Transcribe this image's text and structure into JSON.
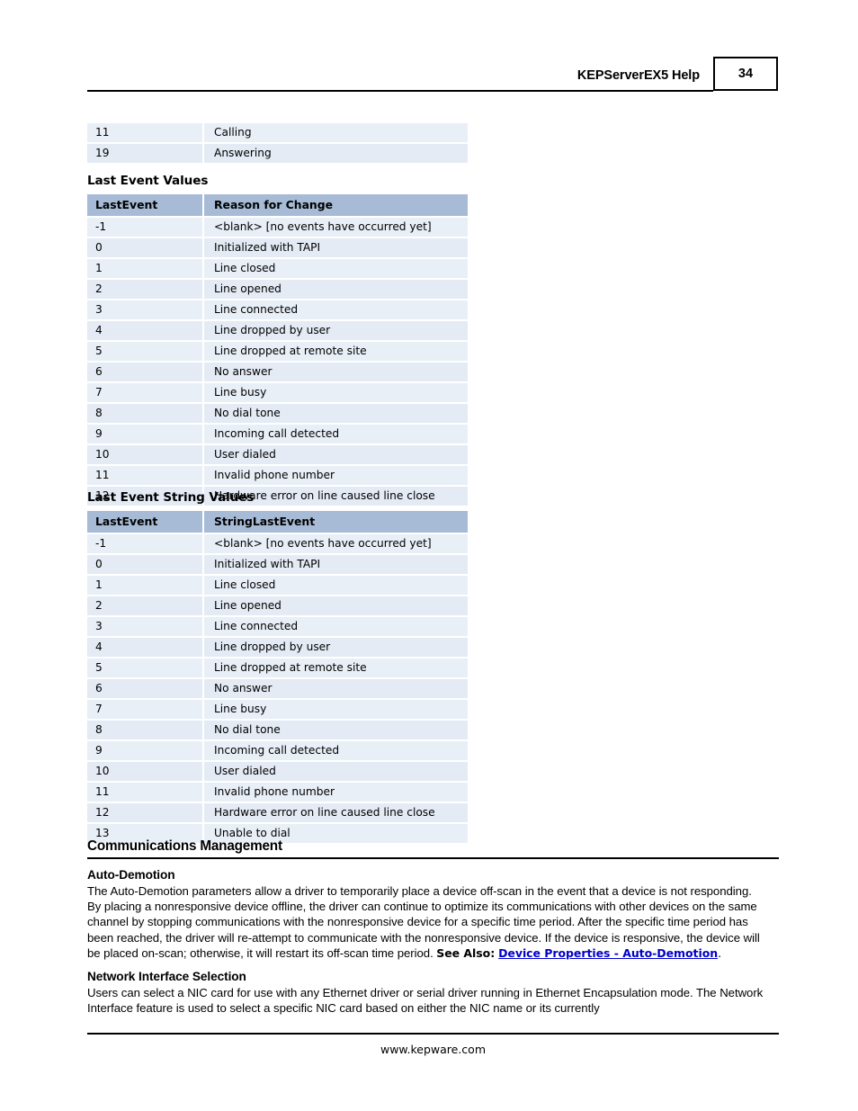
{
  "header": {
    "title": "KEPServerEX5 Help",
    "page_number": "34"
  },
  "tables": {
    "continued_table": {
      "rows": [
        {
          "value": "11",
          "description": "Calling"
        },
        {
          "value": "19",
          "description": "Answering"
        }
      ]
    },
    "last_event_values": {
      "heading": "Last Event Values",
      "columns": [
        "LastEvent",
        "Reason for Change"
      ],
      "rows": [
        {
          "value": "-1",
          "description": "<blank> [no events have occurred yet]"
        },
        {
          "value": "0",
          "description": "Initialized with TAPI"
        },
        {
          "value": "1",
          "description": "Line closed"
        },
        {
          "value": "2",
          "description": "Line opened"
        },
        {
          "value": "3",
          "description": "Line connected"
        },
        {
          "value": "4",
          "description": "Line dropped by user"
        },
        {
          "value": "5",
          "description": "Line dropped at remote site"
        },
        {
          "value": "6",
          "description": "No answer"
        },
        {
          "value": "7",
          "description": "Line busy"
        },
        {
          "value": "8",
          "description": "No dial tone"
        },
        {
          "value": "9",
          "description": "Incoming call detected"
        },
        {
          "value": "10",
          "description": "User dialed"
        },
        {
          "value": "11",
          "description": "Invalid phone number"
        },
        {
          "value": "12",
          "description": "Hardware error on line caused line close"
        }
      ]
    },
    "last_event_string_values": {
      "heading": "Last Event String Values",
      "columns": [
        "LastEvent",
        "StringLastEvent"
      ],
      "rows": [
        {
          "value": "-1",
          "description": "<blank> [no events have occurred yet]"
        },
        {
          "value": "0",
          "description": "Initialized with TAPI"
        },
        {
          "value": "1",
          "description": "Line closed"
        },
        {
          "value": "2",
          "description": "Line opened"
        },
        {
          "value": "3",
          "description": "Line connected"
        },
        {
          "value": "4",
          "description": "Line dropped by user"
        },
        {
          "value": "5",
          "description": "Line dropped at remote site"
        },
        {
          "value": "6",
          "description": "No answer"
        },
        {
          "value": "7",
          "description": "Line busy"
        },
        {
          "value": "8",
          "description": "No dial tone"
        },
        {
          "value": "9",
          "description": "Incoming call detected"
        },
        {
          "value": "10",
          "description": "User dialed"
        },
        {
          "value": "11",
          "description": "Invalid phone number"
        },
        {
          "value": "12",
          "description": "Hardware error on line caused line close"
        },
        {
          "value": "13",
          "description": "Unable to dial"
        }
      ]
    }
  },
  "communications_management": {
    "section_title": "Communications Management",
    "auto_demotion": {
      "title": "Auto-Demotion",
      "body_before_see_also": "The Auto-Demotion parameters allow a driver to temporarily place a device off-scan in the event that a device is not responding. By placing a nonresponsive device offline, the driver can continue to optimize its communications with other devices on the same channel by stopping communications with the nonresponsive device for a specific time period. After the specific time period has been reached, the driver will re-attempt to communicate with the nonresponsive device. If the device is responsive, the device will be placed on-scan; otherwise, it will restart its off-scan time period. ",
      "see_also_label": "See Also:",
      "link_text": "Device Properties - Auto-Demotion",
      "trailing_punctuation": "."
    },
    "network_interface_selection": {
      "title": "Network Interface Selection",
      "body": "Users can select a NIC card for use with any Ethernet driver or serial driver running in Ethernet Encapsulation mode. The Network Interface feature is used to select a specific NIC card based on either the NIC name or its currently"
    }
  },
  "footer": {
    "url": "www.kepware.com"
  },
  "colors": {
    "table_header_bg": "#a7bbd6",
    "row_odd_bg": "#e9eff7",
    "row_even_bg": "#e4ebf5",
    "link": "#0000cc",
    "rule": "#000000"
  }
}
